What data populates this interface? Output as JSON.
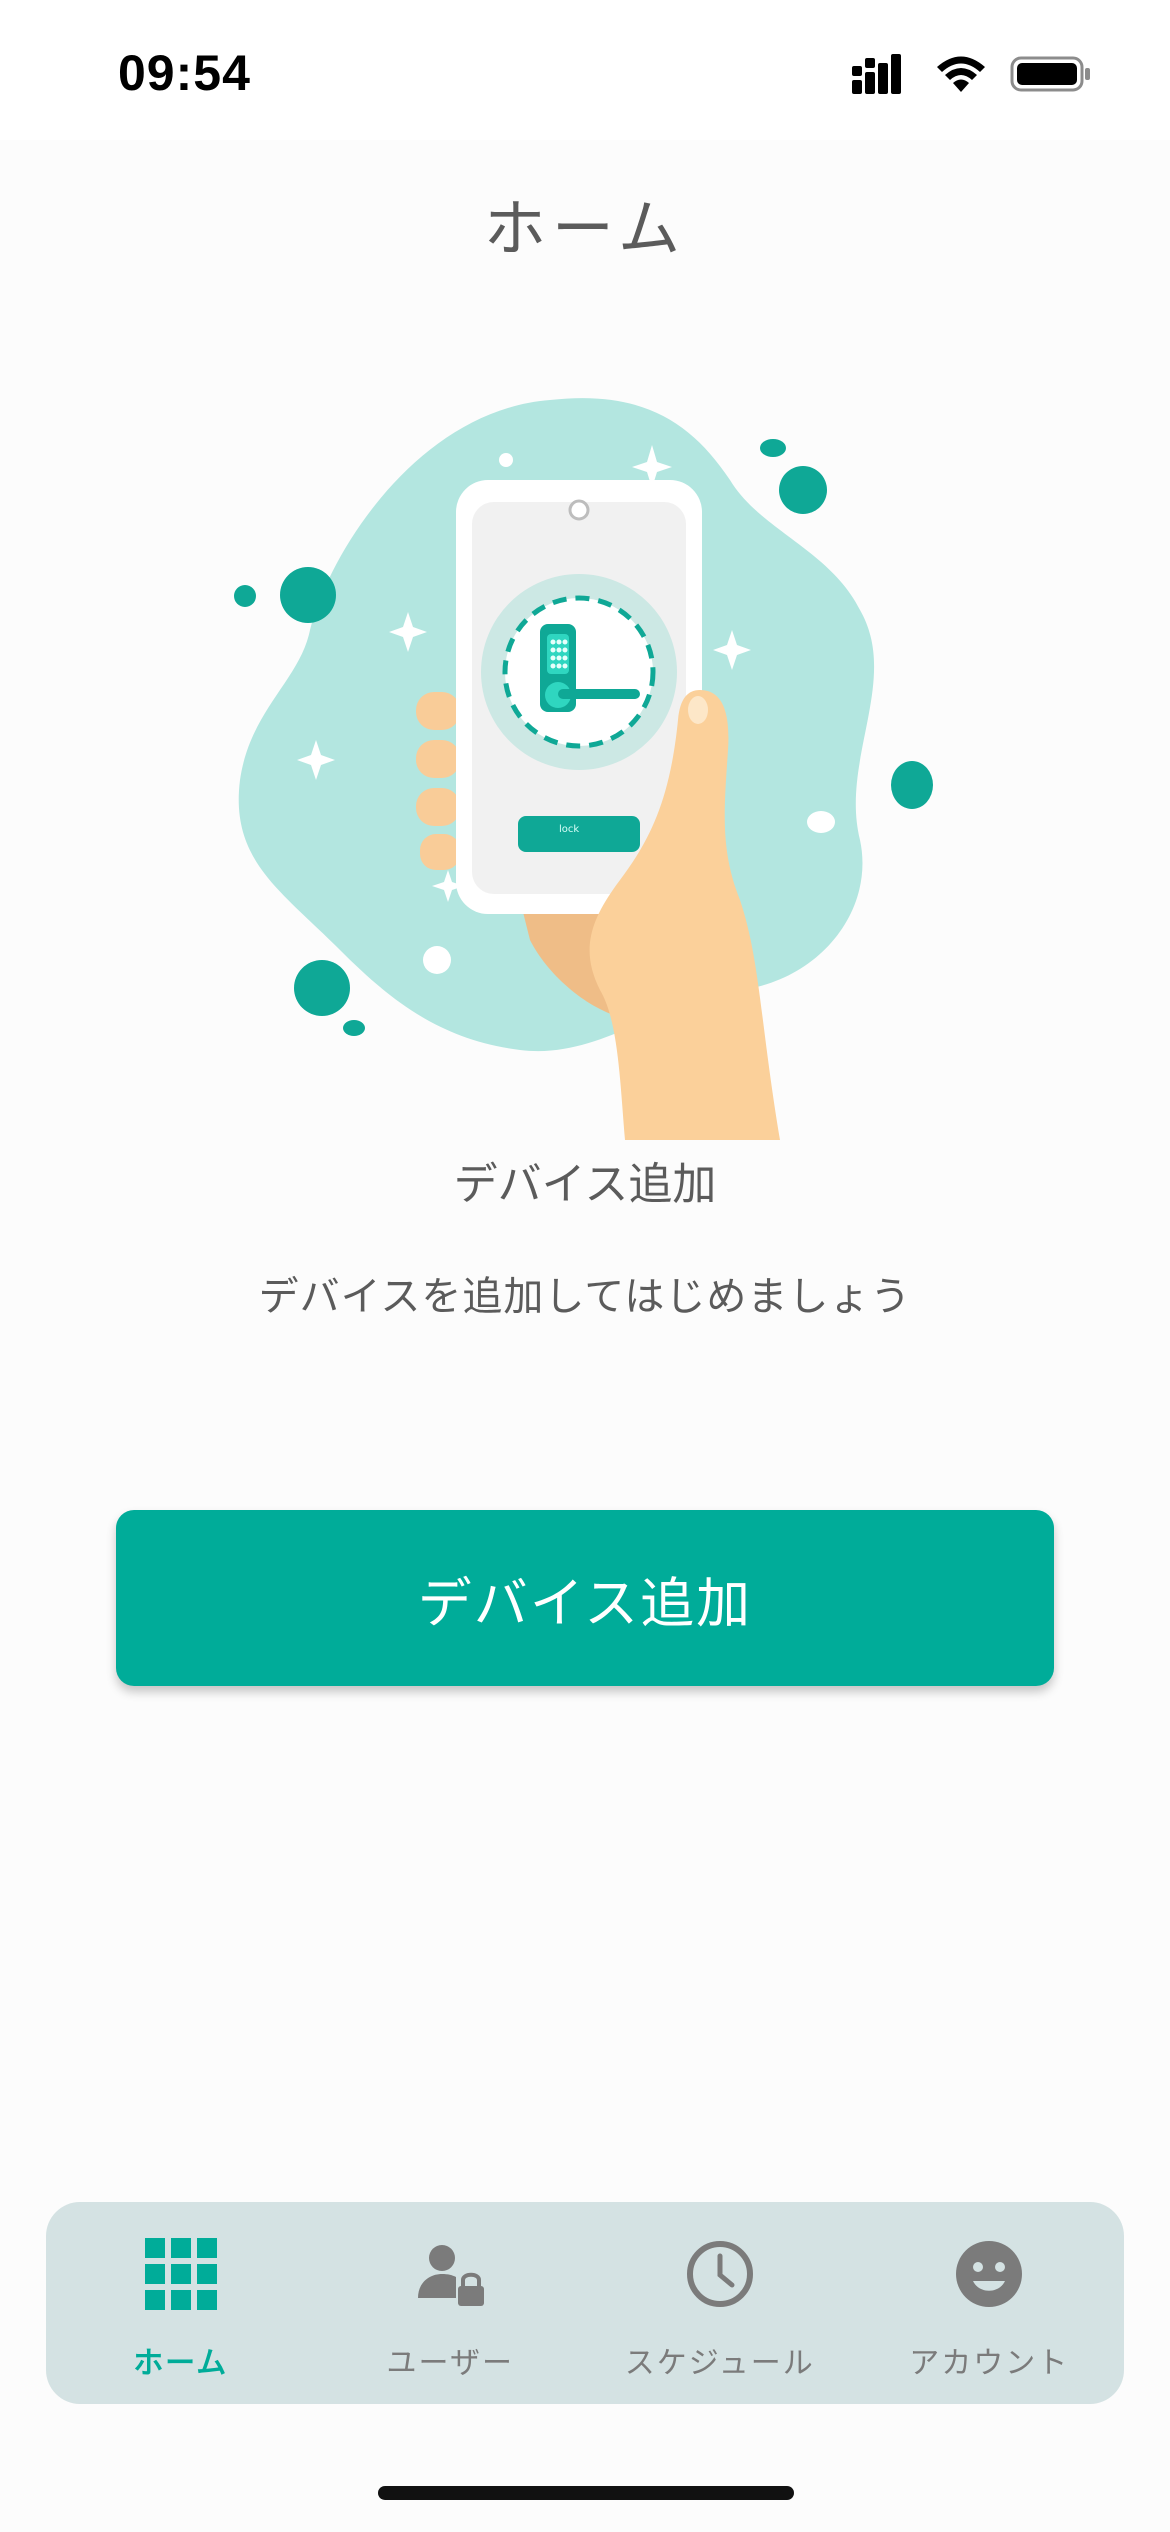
{
  "status_bar": {
    "time": "09:54",
    "icons": [
      "signal-icon",
      "wifi-icon",
      "battery-icon"
    ]
  },
  "header": {
    "title": "ホーム"
  },
  "illustration": {
    "lock_button_label": "lock"
  },
  "empty_state": {
    "title": "デバイス追加",
    "description": "デバイスを追加してはじめましょう"
  },
  "actions": {
    "add_device_label": "デバイス追加"
  },
  "tab_bar": {
    "tabs": [
      {
        "label": "ホーム",
        "icon": "grid-icon",
        "active": true
      },
      {
        "label": "ユーザー",
        "icon": "user-lock-icon",
        "active": false
      },
      {
        "label": "スケジュール",
        "icon": "clock-icon",
        "active": false
      },
      {
        "label": "アカウント",
        "icon": "smiley-icon",
        "active": false
      }
    ]
  },
  "colors": {
    "accent": "#00ac99",
    "tab_bar_background": "#d4e2e3",
    "inactive_icon": "#7b7b7b"
  }
}
